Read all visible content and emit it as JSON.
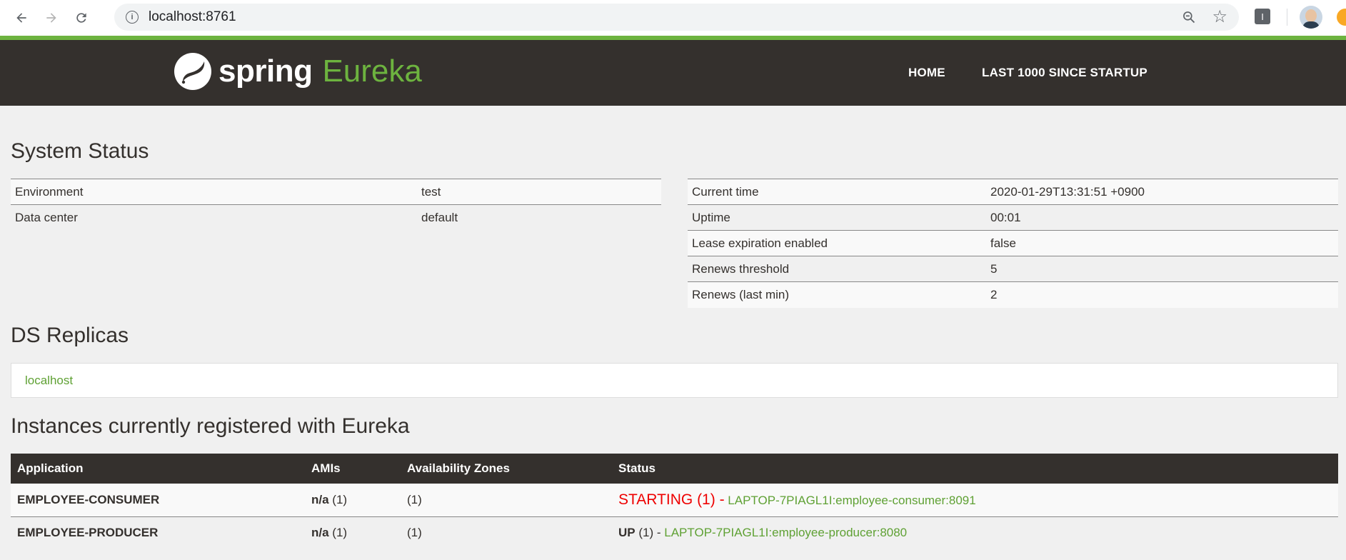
{
  "browser": {
    "url": "localhost:8761",
    "info_glyph": "i",
    "extension_glyph": "I"
  },
  "header": {
    "logo_word": "spring",
    "logo_product": "Eureka",
    "nav": [
      {
        "label": "HOME"
      },
      {
        "label": "LAST 1000 SINCE STARTUP"
      }
    ]
  },
  "system_status": {
    "title": "System Status",
    "left": [
      {
        "key": "Environment",
        "value": "test"
      },
      {
        "key": "Data center",
        "value": "default"
      }
    ],
    "right": [
      {
        "key": "Current time",
        "value": "2020-01-29T13:31:51 +0900"
      },
      {
        "key": "Uptime",
        "value": "00:01"
      },
      {
        "key": "Lease expiration enabled",
        "value": "false"
      },
      {
        "key": "Renews threshold",
        "value": "5"
      },
      {
        "key": "Renews (last min)",
        "value": "2"
      }
    ]
  },
  "replicas": {
    "title": "DS Replicas",
    "items": [
      "localhost"
    ]
  },
  "instances": {
    "title": "Instances currently registered with Eureka",
    "columns": [
      "Application",
      "AMIs",
      "Availability Zones",
      "Status"
    ],
    "rows": [
      {
        "application": "EMPLOYEE-CONSUMER",
        "ami": "n/a",
        "ami_count": "(1)",
        "zones": "(1)",
        "status": "STARTING (1) -",
        "instance": "LAPTOP-7PIAGL1I:employee-consumer:8091"
      },
      {
        "application": "EMPLOYEE-PRODUCER",
        "ami": "n/a",
        "ami_count": "(1)",
        "zones": "(1)",
        "status": "UP",
        "status_count": "(1) -",
        "instance": "LAPTOP-7PIAGL1I:employee-producer:8080"
      }
    ]
  },
  "colors": {
    "brand_green": "#6db33f",
    "header_bg": "#34302d",
    "starting_red": "#ee0000"
  }
}
